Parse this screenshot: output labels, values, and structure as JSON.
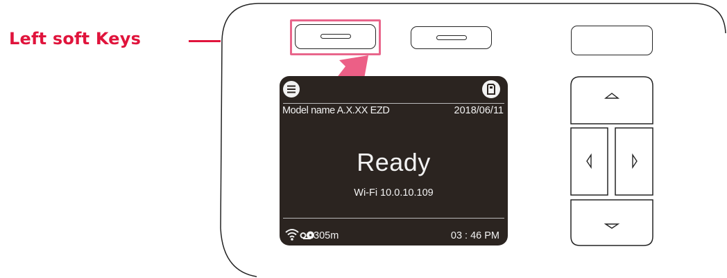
{
  "callout": {
    "label": "Left soft Keys",
    "color": "#e0143c",
    "highlight_color": "#e8658b",
    "arrow_color": "#ec5f86"
  },
  "screen": {
    "model_name": "Model name A.X.XX EZD",
    "date": "2018/06/11",
    "status": "Ready",
    "network": "Wi-Fi 10.0.10.109",
    "ribbon_remaining": "305m",
    "time": "03 : 46 PM",
    "icons": {
      "top_left": "menu-icon",
      "top_right": "sd-card-icon",
      "bottom_wifi": "wifi-icon",
      "bottom_ribbon": "ribbon-icon"
    }
  },
  "keys": {
    "soft_keys": [
      "left-soft-key",
      "middle-soft-key"
    ],
    "function_key": "right-function-key",
    "nav_keys": [
      "up-arrow-key",
      "left-arrow-key",
      "right-arrow-key",
      "down-arrow-key"
    ]
  }
}
